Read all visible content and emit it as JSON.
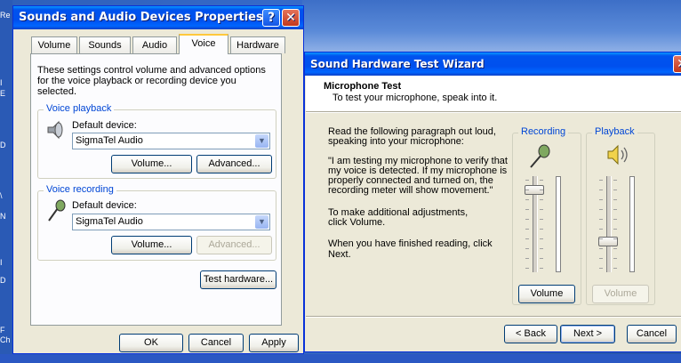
{
  "desktop": {
    "left_labels": [
      "Re",
      "I",
      "E",
      "D",
      "\\",
      "N",
      "I",
      "D",
      "F",
      "Ch"
    ]
  },
  "props_window": {
    "title": "Sounds and Audio Devices Properties",
    "help_glyph": "?",
    "close_glyph": "✕",
    "tabs": [
      "Volume",
      "Sounds",
      "Audio",
      "Voice",
      "Hardware"
    ],
    "active_tab": "Voice",
    "description": "These settings control volume and advanced options for the voice playback or recording device you selected.",
    "voice_playback": {
      "legend": "Voice playback",
      "default_device_label": "Default device:",
      "device": "SigmaTel Audio",
      "volume_button": "Volume...",
      "advanced_button": "Advanced..."
    },
    "voice_recording": {
      "legend": "Voice recording",
      "default_device_label": "Default device:",
      "device": "SigmaTel Audio",
      "volume_button": "Volume...",
      "advanced_button": "Advanced..."
    },
    "test_hardware_button": "Test hardware...",
    "ok_button": "OK",
    "cancel_button": "Cancel",
    "apply_button": "Apply"
  },
  "wizard": {
    "title": "Sound Hardware Test Wizard",
    "close_glyph": "✕",
    "header_title": "Microphone Test",
    "header_subtitle": "To test your microphone, speak into it.",
    "para1": "Read the following paragraph out loud, speaking into your microphone:",
    "para2": "\"I am testing my microphone to verify that my voice is detected. If my microphone is properly connected and turned on, the recording meter will show movement.\"",
    "para3": "To make additional adjustments, click Volume.",
    "para4": "When you have finished reading, click Next.",
    "recording": {
      "legend": "Recording",
      "volume_button": "Volume",
      "slider_level": 0.9,
      "meter_level": 0.0
    },
    "playback": {
      "legend": "Playback",
      "volume_button": "Volume",
      "slider_level": 0.3,
      "meter_level": 0.0
    },
    "back_button": "< Back",
    "next_button": "Next >",
    "cancel_button": "Cancel"
  },
  "colors": {
    "title_blue": "#0053ee",
    "legend_blue": "#0046d5",
    "window_face": "#ece9d8"
  }
}
